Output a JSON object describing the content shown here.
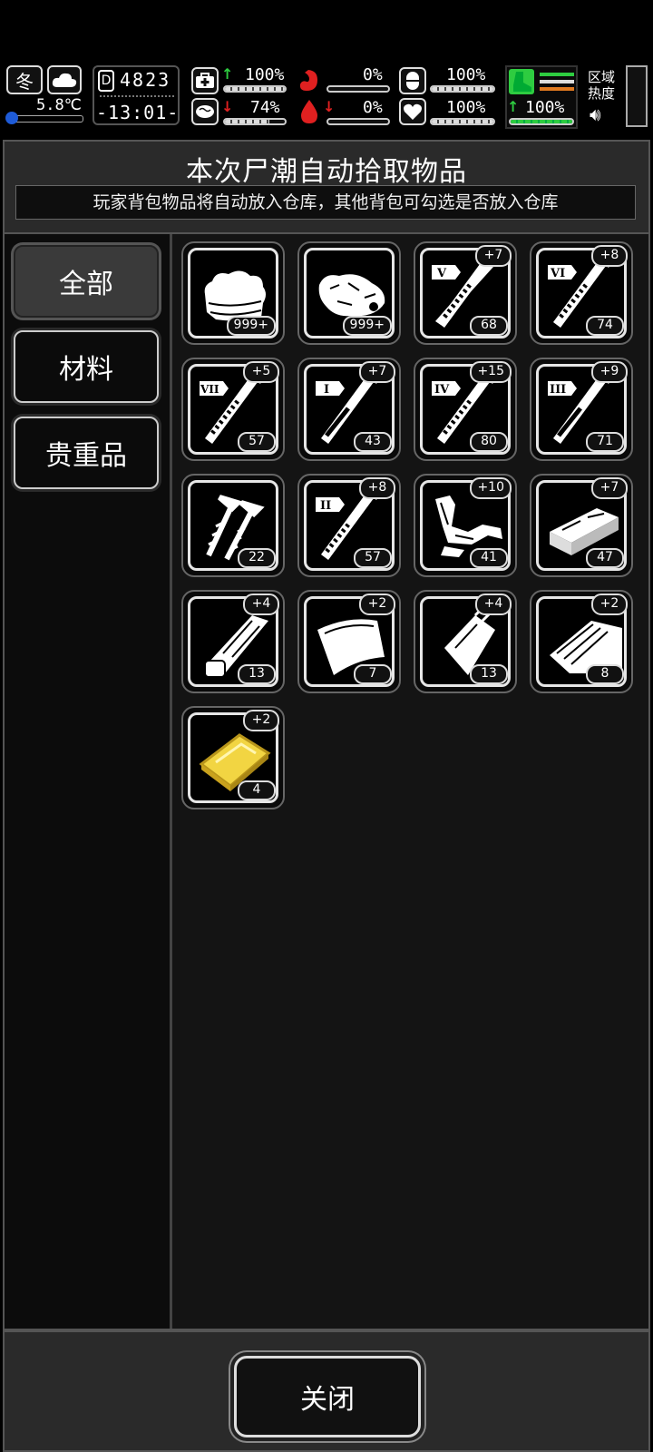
{
  "status_bar": {
    "season": "冬",
    "weather_icon": "cloud-icon",
    "temperature": "5.8℃",
    "day": "4823",
    "day_prefix": "D",
    "time": "-13:01-",
    "health": "100%",
    "health_fill": 100,
    "food": "0%",
    "food_fill": 0,
    "stamina": "100%",
    "stamina_fill": 100,
    "sanity": "74%",
    "sanity_fill": 74,
    "water": "0%",
    "water_fill": 0,
    "mood": "100%",
    "mood_fill": 100,
    "speed": "100%",
    "speed_fill": 100,
    "zone_heat_label": "区域\n热度",
    "colors": {
      "green": "#2ecc40",
      "red": "#e02020",
      "orange": "#e07a20"
    }
  },
  "dialog": {
    "title": "本次尸潮自动拾取物品",
    "subtitle": "玩家背包物品将自动放入仓库，其他背包可勾选是否放入仓库",
    "tabs": [
      {
        "label": "全部",
        "active": true
      },
      {
        "label": "材料",
        "active": false
      },
      {
        "label": "贵重品",
        "active": false
      }
    ],
    "items": [
      {
        "icon": "cloth-icon",
        "count": "999+",
        "bonus": ""
      },
      {
        "icon": "raw-meat-icon",
        "count": "999+",
        "bonus": ""
      },
      {
        "icon": "syringe-v-icon",
        "roman": "V",
        "count": "68",
        "bonus": "+7"
      },
      {
        "icon": "syringe-vi-icon",
        "roman": "VI",
        "count": "74",
        "bonus": "+8"
      },
      {
        "icon": "syringe-vii-icon",
        "roman": "VII",
        "count": "57",
        "bonus": "+5"
      },
      {
        "icon": "syringe-i-icon",
        "roman": "I",
        "count": "43",
        "bonus": "+7"
      },
      {
        "icon": "syringe-iv-icon",
        "roman": "IV",
        "count": "80",
        "bonus": "+15"
      },
      {
        "icon": "syringe-iii-icon",
        "roman": "III",
        "count": "71",
        "bonus": "+9"
      },
      {
        "icon": "screws-icon",
        "count": "22",
        "bonus": ""
      },
      {
        "icon": "syringe-ii-icon",
        "roman": "II",
        "count": "57",
        "bonus": "+8"
      },
      {
        "icon": "scrap-metal-icon",
        "count": "41",
        "bonus": "+10"
      },
      {
        "icon": "whetstone-icon",
        "count": "47",
        "bonus": "+7"
      },
      {
        "icon": "wood-plank-icon",
        "count": "13",
        "bonus": "+4"
      },
      {
        "icon": "leather-icon",
        "count": "7",
        "bonus": "+2"
      },
      {
        "icon": "plastic-bag-icon",
        "count": "13",
        "bonus": "+4"
      },
      {
        "icon": "wood-board-icon",
        "count": "8",
        "bonus": "+2"
      },
      {
        "icon": "gold-bar-icon",
        "count": "4",
        "bonus": "+2"
      }
    ],
    "close_label": "关闭"
  }
}
